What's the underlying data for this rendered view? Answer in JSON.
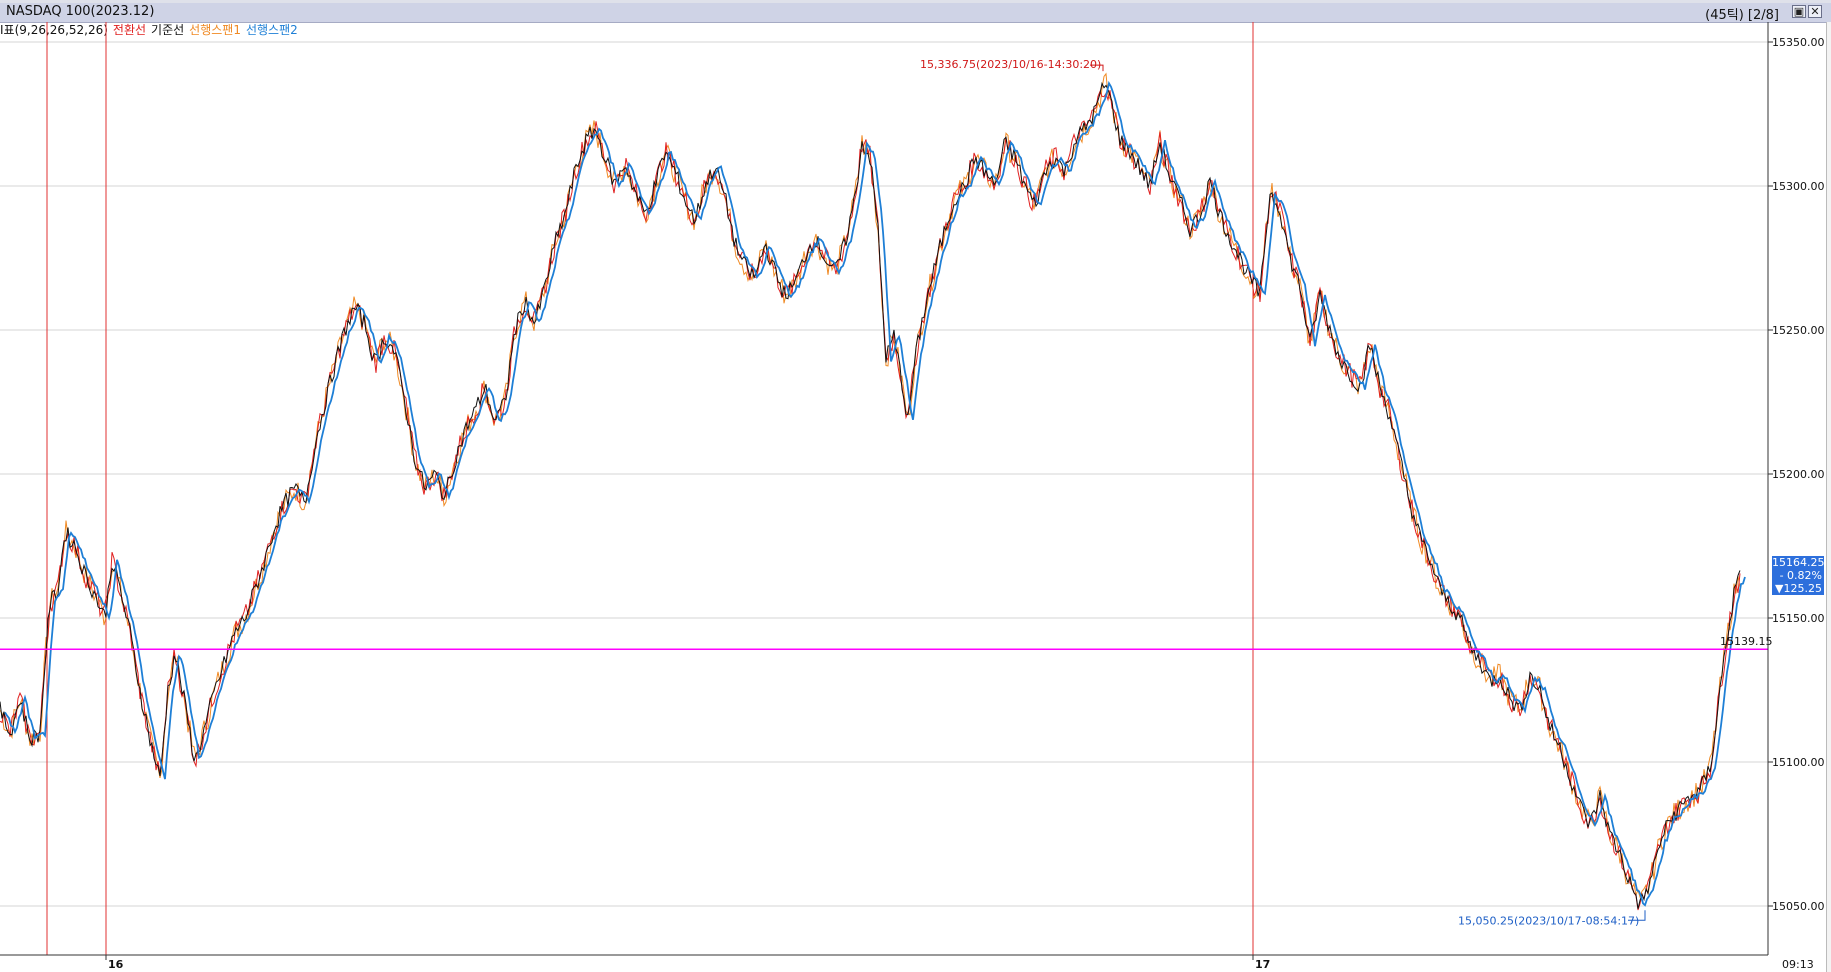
{
  "window": {
    "title": "NASDAQ 100(2023.12)",
    "tick_info": "(45틱) [2/8]",
    "buttons": [
      "restore",
      "close"
    ],
    "panel_button": "LU"
  },
  "legend": {
    "indicator": "I표(9,26,26,52,26)",
    "items": [
      {
        "label": "전환선",
        "color": "#e02020"
      },
      {
        "label": "기준선",
        "color": "#111111"
      },
      {
        "label": "선행스팬1",
        "color": "#f08a24"
      },
      {
        "label": "선행스팬2",
        "color": "#1e7fd6"
      }
    ]
  },
  "price_badge": {
    "price": "15164.25",
    "change_pct": "- 0.82%",
    "change": "▼125.25"
  },
  "reference_line": {
    "value": 15139.15,
    "label": "15139.15",
    "color": "#ff00ff"
  },
  "annotations": {
    "high": {
      "text": "15,336.75(2023/10/16-14:30:20)",
      "value": 15336.75,
      "color": "#d01818"
    },
    "low": {
      "text": "15,050.25(2023/10/17-08:54:17)",
      "value": 15050.25,
      "color": "#1e5fc6"
    }
  },
  "x_labels": {
    "day1": "16",
    "day2": "17",
    "time": "09:13"
  },
  "chart_data": {
    "type": "line",
    "title": "NASDAQ 100(2023.12)",
    "xlabel": "",
    "ylabel": "",
    "ylim": [
      15040,
      15360
    ],
    "yticks": [
      15050,
      15100,
      15150,
      15200,
      15250,
      15300,
      15350
    ],
    "ytick_labels": [
      "15050.00",
      "15100.00",
      "15150.00",
      "15200.00",
      "15250.00",
      "15300.00",
      "15350.00"
    ],
    "grid": true,
    "day_separators": [
      "15",
      "16",
      "17"
    ],
    "price_path": [
      [
        0,
        15118
      ],
      [
        10,
        15110
      ],
      [
        20,
        15122
      ],
      [
        30,
        15108
      ],
      [
        40,
        15110
      ],
      [
        45,
        15135
      ],
      [
        50,
        15155
      ],
      [
        58,
        15160
      ],
      [
        65,
        15180
      ],
      [
        75,
        15175
      ],
      [
        85,
        15165
      ],
      [
        95,
        15158
      ],
      [
        105,
        15150
      ],
      [
        112,
        15170
      ],
      [
        120,
        15160
      ],
      [
        130,
        15145
      ],
      [
        140,
        15125
      ],
      [
        150,
        15108
      ],
      [
        160,
        15094
      ],
      [
        168,
        15125
      ],
      [
        175,
        15138
      ],
      [
        185,
        15120
      ],
      [
        195,
        15100
      ],
      [
        205,
        15112
      ],
      [
        215,
        15125
      ],
      [
        225,
        15135
      ],
      [
        235,
        15145
      ],
      [
        245,
        15150
      ],
      [
        255,
        15160
      ],
      [
        265,
        15170
      ],
      [
        275,
        15182
      ],
      [
        285,
        15190
      ],
      [
        295,
        15195
      ],
      [
        305,
        15190
      ],
      [
        315,
        15210
      ],
      [
        325,
        15225
      ],
      [
        335,
        15238
      ],
      [
        345,
        15250
      ],
      [
        355,
        15258
      ],
      [
        365,
        15252
      ],
      [
        375,
        15238
      ],
      [
        385,
        15248
      ],
      [
        395,
        15242
      ],
      [
        405,
        15225
      ],
      [
        415,
        15205
      ],
      [
        425,
        15195
      ],
      [
        435,
        15200
      ],
      [
        445,
        15192
      ],
      [
        455,
        15205
      ],
      [
        465,
        15215
      ],
      [
        475,
        15222
      ],
      [
        485,
        15230
      ],
      [
        495,
        15218
      ],
      [
        505,
        15225
      ],
      [
        515,
        15250
      ],
      [
        525,
        15260
      ],
      [
        535,
        15252
      ],
      [
        545,
        15265
      ],
      [
        555,
        15280
      ],
      [
        565,
        15290
      ],
      [
        575,
        15305
      ],
      [
        585,
        15315
      ],
      [
        595,
        15320
      ],
      [
        605,
        15310
      ],
      [
        615,
        15300
      ],
      [
        625,
        15308
      ],
      [
        635,
        15298
      ],
      [
        645,
        15290
      ],
      [
        655,
        15300
      ],
      [
        665,
        15312
      ],
      [
        675,
        15305
      ],
      [
        685,
        15295
      ],
      [
        695,
        15288
      ],
      [
        705,
        15300
      ],
      [
        715,
        15307
      ],
      [
        725,
        15296
      ],
      [
        735,
        15280
      ],
      [
        745,
        15272
      ],
      [
        755,
        15268
      ],
      [
        765,
        15280
      ],
      [
        775,
        15270
      ],
      [
        785,
        15262
      ],
      [
        795,
        15266
      ],
      [
        805,
        15276
      ],
      [
        815,
        15282
      ],
      [
        825,
        15275
      ],
      [
        835,
        15270
      ],
      [
        845,
        15280
      ],
      [
        855,
        15296
      ],
      [
        862,
        15315
      ],
      [
        870,
        15310
      ],
      [
        878,
        15285
      ],
      [
        886,
        15240
      ],
      [
        894,
        15248
      ],
      [
        902,
        15232
      ],
      [
        908,
        15218
      ],
      [
        915,
        15240
      ],
      [
        925,
        15258
      ],
      [
        935,
        15272
      ],
      [
        945,
        15285
      ],
      [
        955,
        15296
      ],
      [
        965,
        15300
      ],
      [
        975,
        15310
      ],
      [
        985,
        15305
      ],
      [
        995,
        15300
      ],
      [
        1005,
        15315
      ],
      [
        1015,
        15310
      ],
      [
        1025,
        15300
      ],
      [
        1035,
        15293
      ],
      [
        1045,
        15305
      ],
      [
        1055,
        15310
      ],
      [
        1065,
        15305
      ],
      [
        1075,
        15316
      ],
      [
        1085,
        15320
      ],
      [
        1095,
        15326
      ],
      [
        1105,
        15336
      ],
      [
        1112,
        15328
      ],
      [
        1120,
        15316
      ],
      [
        1130,
        15312
      ],
      [
        1140,
        15306
      ],
      [
        1150,
        15300
      ],
      [
        1160,
        15315
      ],
      [
        1170,
        15303
      ],
      [
        1180,
        15295
      ],
      [
        1190,
        15285
      ],
      [
        1200,
        15290
      ],
      [
        1210,
        15302
      ],
      [
        1220,
        15290
      ],
      [
        1230,
        15282
      ],
      [
        1240,
        15275
      ],
      [
        1250,
        15268
      ],
      [
        1260,
        15262
      ],
      [
        1270,
        15298
      ],
      [
        1280,
        15292
      ],
      [
        1290,
        15275
      ],
      [
        1300,
        15265
      ],
      [
        1310,
        15245
      ],
      [
        1320,
        15262
      ],
      [
        1330,
        15250
      ],
      [
        1340,
        15240
      ],
      [
        1350,
        15235
      ],
      [
        1360,
        15230
      ],
      [
        1370,
        15245
      ],
      [
        1380,
        15230
      ],
      [
        1390,
        15220
      ],
      [
        1400,
        15205
      ],
      [
        1410,
        15190
      ],
      [
        1420,
        15178
      ],
      [
        1430,
        15170
      ],
      [
        1440,
        15160
      ],
      [
        1450,
        15155
      ],
      [
        1460,
        15150
      ],
      [
        1470,
        15140
      ],
      [
        1480,
        15135
      ],
      [
        1490,
        15128
      ],
      [
        1500,
        15130
      ],
      [
        1510,
        15122
      ],
      [
        1520,
        15118
      ],
      [
        1530,
        15130
      ],
      [
        1540,
        15125
      ],
      [
        1550,
        15112
      ],
      [
        1560,
        15105
      ],
      [
        1570,
        15095
      ],
      [
        1580,
        15085
      ],
      [
        1590,
        15078
      ],
      [
        1600,
        15088
      ],
      [
        1610,
        15075
      ],
      [
        1620,
        15068
      ],
      [
        1630,
        15058
      ],
      [
        1640,
        15050
      ],
      [
        1650,
        15058
      ],
      [
        1660,
        15072
      ],
      [
        1670,
        15080
      ],
      [
        1680,
        15084
      ],
      [
        1690,
        15088
      ],
      [
        1700,
        15090
      ],
      [
        1710,
        15098
      ],
      [
        1715,
        15110
      ],
      [
        1720,
        15125
      ],
      [
        1725,
        15138
      ],
      [
        1730,
        15150
      ],
      [
        1735,
        15160
      ],
      [
        1740,
        15164
      ]
    ]
  }
}
